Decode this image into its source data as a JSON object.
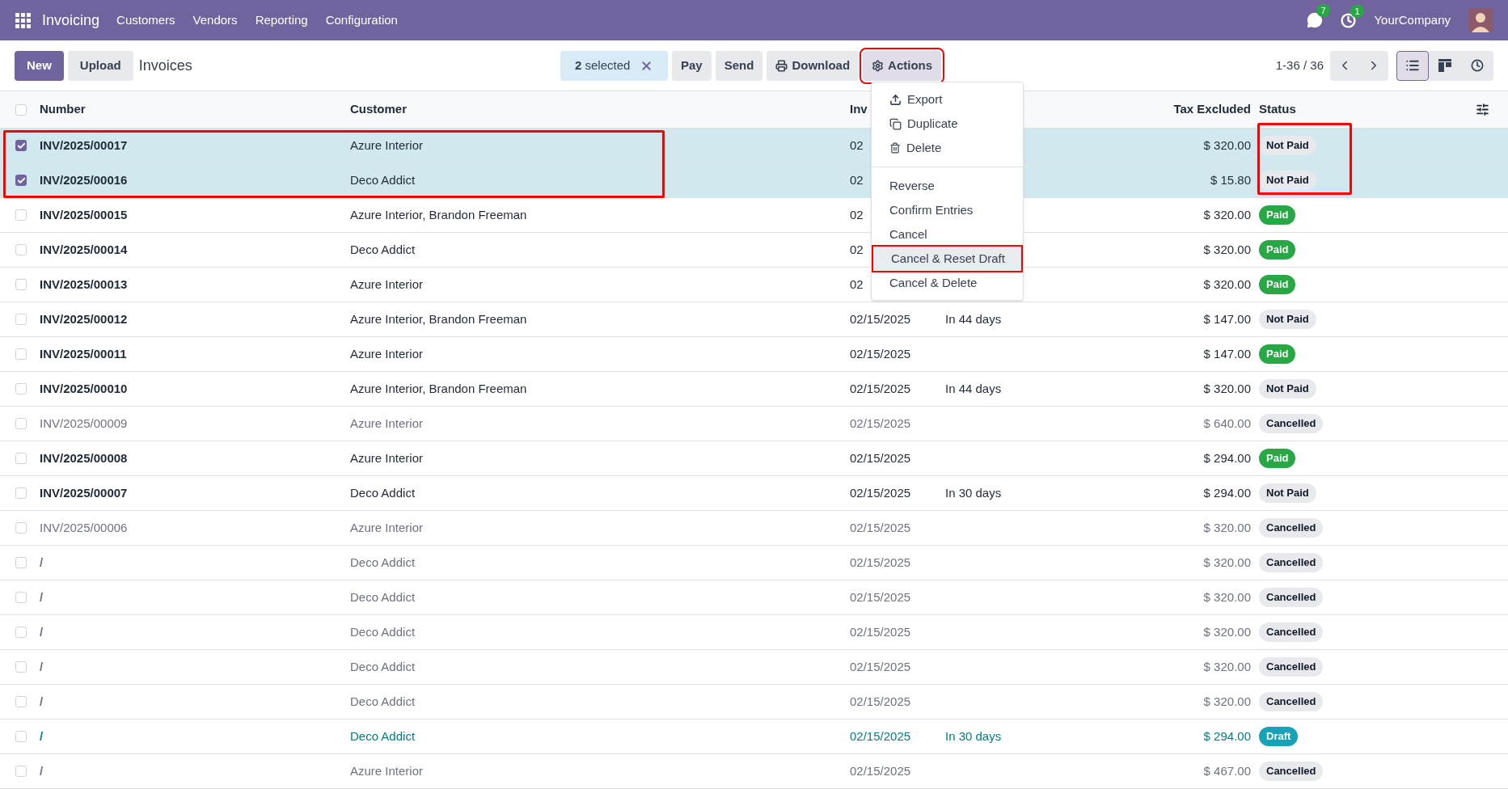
{
  "navbar": {
    "app": "Invoicing",
    "menu": [
      "Customers",
      "Vendors",
      "Reporting",
      "Configuration"
    ],
    "messages_badge": "7",
    "activities_badge": "1",
    "company": "YourCompany"
  },
  "toolbar": {
    "buttons": [
      {
        "label": "New",
        "kind": "primary"
      },
      {
        "label": "Upload",
        "kind": "secondary"
      }
    ],
    "title": "Invoices",
    "selection": {
      "count": "2",
      "label": "selected"
    },
    "actions": [
      {
        "label": "Pay",
        "highlighted": false
      },
      {
        "label": "Send",
        "highlighted": false
      },
      {
        "label": "Download",
        "highlighted": false
      },
      {
        "label": "Actions",
        "highlighted": true
      }
    ],
    "pager": "1-36 / 36",
    "views": [
      {
        "kind": "list",
        "selected": true
      },
      {
        "kind": "kanban",
        "selected": false
      },
      {
        "kind": "activity",
        "selected": false
      }
    ]
  },
  "actions_menu": [
    {
      "label": "Export",
      "kind": "icon",
      "highlighted": false
    },
    {
      "label": "Duplicate",
      "kind": "icon",
      "highlighted": false
    },
    {
      "label": "Delete",
      "kind": "icon",
      "highlighted": false
    },
    {
      "label": "Reverse",
      "kind": "plain",
      "highlighted": false
    },
    {
      "label": "Confirm Entries",
      "kind": "plain",
      "highlighted": false
    },
    {
      "label": "Cancel",
      "kind": "plain",
      "highlighted": false
    },
    {
      "label": "Cancel & Reset Draft",
      "kind": "plain",
      "highlighted": true
    },
    {
      "label": "Cancel & Delete",
      "kind": "plain",
      "highlighted": false
    }
  ],
  "table": {
    "all_selected": false,
    "columns": [
      "Number",
      "Customer",
      "Inv",
      "Tax Excluded",
      "Status"
    ],
    "rows": [
      {
        "number": "INV/2025/00017",
        "customer": "Azure Interior",
        "date": "02",
        "amount": "$ 320.00",
        "status": "Not Paid",
        "color": "#e7e9ed",
        "kind": "posted",
        "selected": true,
        "highlighted": true
      },
      {
        "number": "INV/2025/00016",
        "customer": "Deco Addict",
        "date": "02",
        "amount": "$ 15.80",
        "status": "Not Paid",
        "color": "#e7e9ed",
        "kind": "posted",
        "selected": true,
        "highlighted": true
      },
      {
        "number": "INV/2025/00015",
        "customer": "Azure Interior, Brandon Freeman",
        "date": "02",
        "amount": "$ 320.00",
        "status": "Paid",
        "color": "#28a745",
        "kind": "posted",
        "selected": false,
        "highlighted": false
      },
      {
        "number": "INV/2025/00014",
        "customer": "Deco Addict",
        "date": "02",
        "amount": "$ 320.00",
        "status": "Paid",
        "color": "#28a745",
        "kind": "posted",
        "selected": false,
        "highlighted": false
      },
      {
        "number": "INV/2025/00013",
        "customer": "Azure Interior",
        "date": "02",
        "amount": "$ 320.00",
        "status": "Paid",
        "color": "#28a745",
        "kind": "posted",
        "selected": false,
        "highlighted": false
      },
      {
        "number": "INV/2025/00012",
        "customer": "Azure Interior, Brandon Freeman",
        "date": "02/15/2025",
        "due": "In 44 days",
        "amount": "$ 147.00",
        "status": "Not Paid",
        "color": "#e7e9ed",
        "kind": "posted",
        "selected": false,
        "highlighted": false
      },
      {
        "number": "INV/2025/00011",
        "customer": "Azure Interior",
        "date": "02/15/2025",
        "amount": "$ 147.00",
        "status": "Paid",
        "color": "#28a745",
        "kind": "posted",
        "selected": false,
        "highlighted": false
      },
      {
        "number": "INV/2025/00010",
        "customer": "Azure Interior, Brandon Freeman",
        "date": "02/15/2025",
        "due": "In 44 days",
        "amount": "$ 320.00",
        "status": "Not Paid",
        "color": "#e7e9ed",
        "kind": "posted",
        "selected": false,
        "highlighted": false
      },
      {
        "number": "INV/2025/00009",
        "customer": "Azure Interior",
        "date": "02/15/2025",
        "amount": "$ 640.00",
        "status": "Cancelled",
        "color": "#e7e9ed",
        "kind": "cancelled",
        "selected": false,
        "highlighted": false
      },
      {
        "number": "INV/2025/00008",
        "customer": "Azure Interior",
        "date": "02/15/2025",
        "amount": "$ 294.00",
        "status": "Paid",
        "color": "#28a745",
        "kind": "posted",
        "selected": false,
        "highlighted": false
      },
      {
        "number": "INV/2025/00007",
        "customer": "Deco Addict",
        "date": "02/15/2025",
        "due": "In 30 days",
        "amount": "$ 294.00",
        "status": "Not Paid",
        "color": "#e7e9ed",
        "kind": "posted",
        "selected": false,
        "highlighted": false
      },
      {
        "number": "INV/2025/00006",
        "customer": "Azure Interior",
        "date": "02/15/2025",
        "amount": "$ 320.00",
        "status": "Cancelled",
        "color": "#e7e9ed",
        "kind": "cancelled",
        "selected": false,
        "highlighted": false
      },
      {
        "number": "/",
        "customer": "Deco Addict",
        "date": "02/15/2025",
        "amount": "$ 320.00",
        "status": "Cancelled",
        "color": "#e7e9ed",
        "kind": "cancelled",
        "selected": false,
        "highlighted": false
      },
      {
        "number": "/",
        "customer": "Deco Addict",
        "date": "02/15/2025",
        "amount": "$ 320.00",
        "status": "Cancelled",
        "color": "#e7e9ed",
        "kind": "cancelled",
        "selected": false,
        "highlighted": false
      },
      {
        "number": "/",
        "customer": "Deco Addict",
        "date": "02/15/2025",
        "amount": "$ 320.00",
        "status": "Cancelled",
        "color": "#e7e9ed",
        "kind": "cancelled",
        "selected": false,
        "highlighted": false
      },
      {
        "number": "/",
        "customer": "Deco Addict",
        "date": "02/15/2025",
        "amount": "$ 320.00",
        "status": "Cancelled",
        "color": "#e7e9ed",
        "kind": "cancelled",
        "selected": false,
        "highlighted": false
      },
      {
        "number": "/",
        "customer": "Deco Addict",
        "date": "02/15/2025",
        "amount": "$ 320.00",
        "status": "Cancelled",
        "color": "#e7e9ed",
        "kind": "cancelled",
        "selected": false,
        "highlighted": false
      },
      {
        "number": "/",
        "customer": "Deco Addict",
        "date": "02/15/2025",
        "due": "In 30 days",
        "amount": "$ 294.00",
        "status": "Draft",
        "color": "#17a2b8",
        "kind": "draft",
        "selected": false,
        "highlighted": false
      },
      {
        "number": "/",
        "customer": "Azure Interior",
        "date": "02/15/2025",
        "amount": "$ 467.00",
        "status": "Cancelled",
        "color": "#e7e9ed",
        "kind": "cancelled",
        "selected": false,
        "highlighted": false
      }
    ]
  }
}
